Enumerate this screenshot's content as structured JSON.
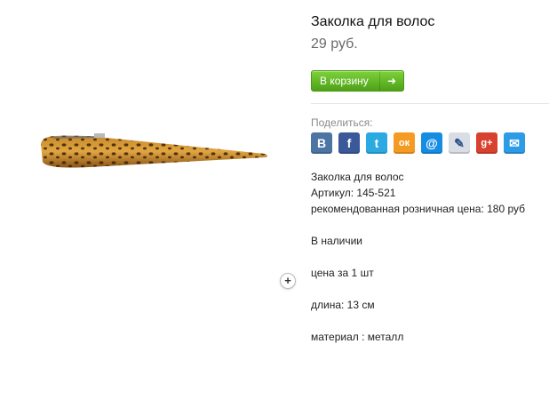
{
  "product": {
    "title": "Заколка для волос",
    "price": "29 руб.",
    "cart_button": "В корзину"
  },
  "share": {
    "label": "Поделиться:",
    "icons": [
      {
        "name": "vkontakte-icon",
        "glyph": "B",
        "color": "#4c75a3"
      },
      {
        "name": "facebook-icon",
        "glyph": "f",
        "color": "#3b5998"
      },
      {
        "name": "twitter-icon",
        "glyph": "t",
        "color": "#2ba9e1"
      },
      {
        "name": "odnoklassniki-icon",
        "glyph": "ок",
        "color": "#f59a23"
      },
      {
        "name": "mail-ru-icon",
        "glyph": "@",
        "color": "#168de2"
      },
      {
        "name": "livejournal-icon",
        "glyph": "✎",
        "color": "#d9dee5"
      },
      {
        "name": "google-plus-icon",
        "glyph": "g+",
        "color": "#d9412f"
      },
      {
        "name": "email-icon",
        "glyph": "✉",
        "color": "#2d9be6"
      }
    ]
  },
  "description": {
    "line1": "Заколка для волос",
    "line2": "Артикул: 145-521",
    "line3": "рекомендованная розничная цена: 180 руб",
    "availability": "В наличии",
    "unit": "цена за 1 шт",
    "length": "длина: 13 см",
    "material": "материал : металл"
  },
  "colors": {
    "accent_green": "#5bb41f",
    "price_gray": "#6a6a6a"
  }
}
